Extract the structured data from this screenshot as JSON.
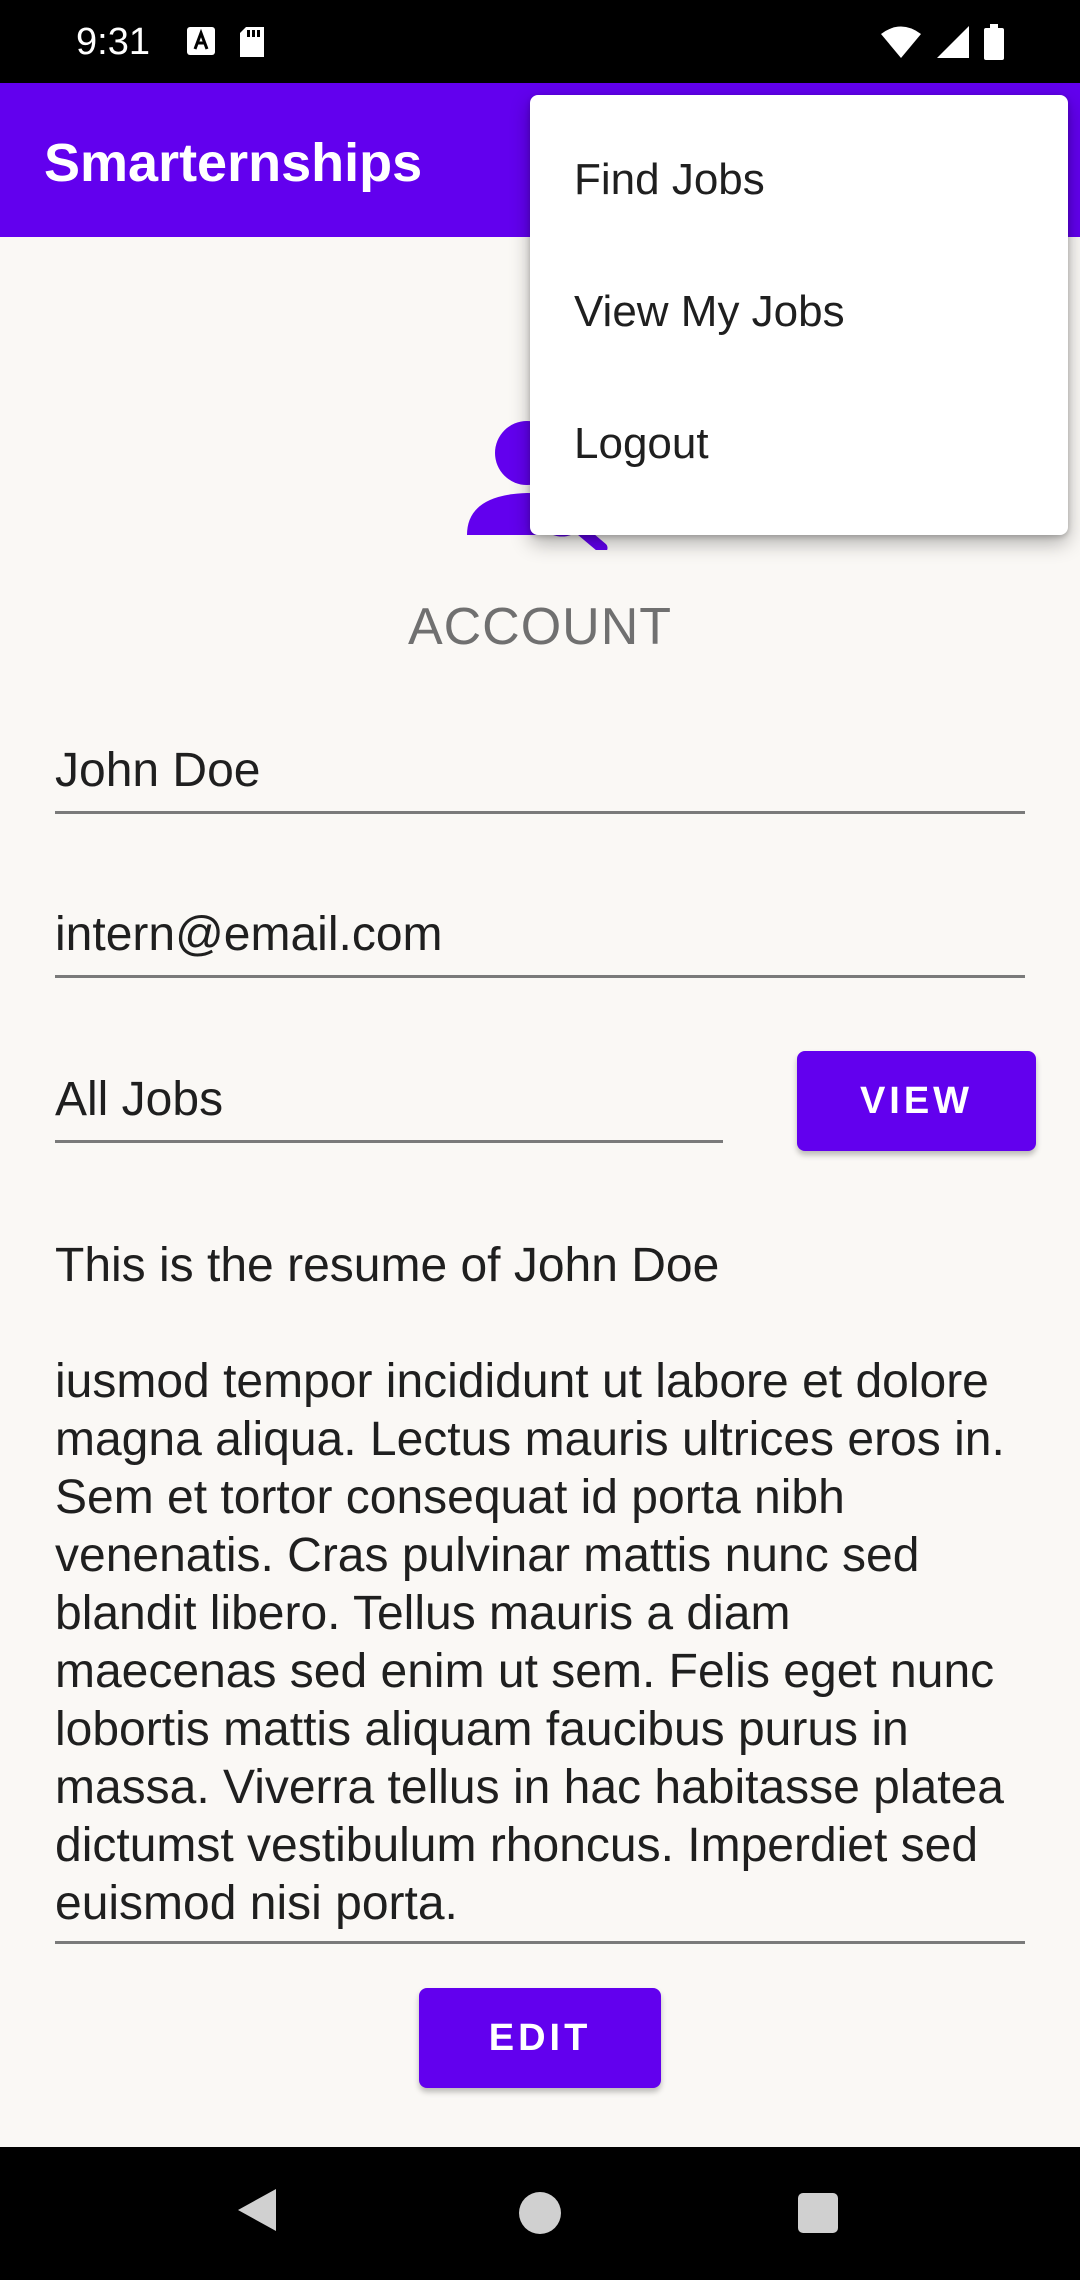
{
  "status_bar": {
    "time": "9:31",
    "icons_left": [
      "a-notification-icon",
      "sd-card-icon"
    ],
    "icons_right": [
      "wifi-icon",
      "signal-icon",
      "battery-icon"
    ]
  },
  "app_bar": {
    "title": "Smarternships",
    "color": "#6200EE"
  },
  "menu": {
    "items": [
      {
        "label": "Find Jobs"
      },
      {
        "label": "View My Jobs"
      },
      {
        "label": "Logout"
      }
    ]
  },
  "profile": {
    "icon": "account-search-icon",
    "label": "ACCOUNT"
  },
  "form": {
    "name_value": "John Doe",
    "email_value": "intern@email.com",
    "jobs_value": "All Jobs",
    "view_button": "VIEW",
    "resume_title": "This is the resume of John Doe",
    "resume_body": "iusmod tempor incididunt ut labore et dolore magna aliqua. Lectus mauris ultrices eros in. Sem et tortor consequat id porta nibh venenatis. Cras pulvinar mattis nunc sed blandit libero. Tellus mauris a diam maecenas sed enim ut sem. Felis eget nunc lobortis mattis aliquam faucibus purus in massa. Viverra tellus in hac habitasse platea dictumst vestibulum rhoncus. Imperdiet sed euismod nisi porta.",
    "edit_button": "EDIT"
  },
  "nav_bar": {
    "buttons": [
      "back-icon",
      "home-icon",
      "recents-icon"
    ]
  }
}
